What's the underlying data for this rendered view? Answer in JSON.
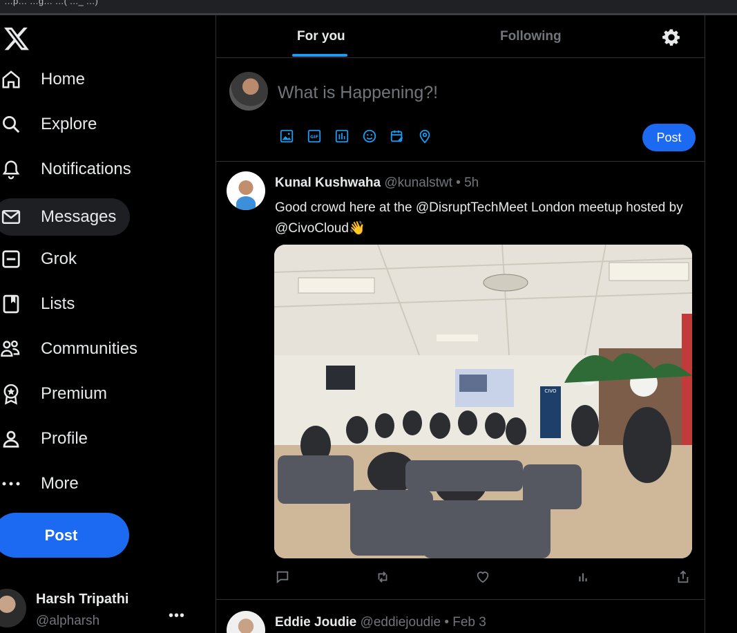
{
  "browser": {
    "url_fragment": "…p… …g… …( …_ …)"
  },
  "sidebar": {
    "items": [
      {
        "label": "Home",
        "icon": "home-icon"
      },
      {
        "label": "Explore",
        "icon": "search-icon"
      },
      {
        "label": "Notifications",
        "icon": "bell-icon"
      },
      {
        "label": "Messages",
        "icon": "envelope-icon",
        "active": true
      },
      {
        "label": "Grok",
        "icon": "grok-icon"
      },
      {
        "label": "Lists",
        "icon": "lists-icon"
      },
      {
        "label": "Communities",
        "icon": "communities-icon"
      },
      {
        "label": "Premium",
        "icon": "premium-icon"
      },
      {
        "label": "Profile",
        "icon": "profile-icon"
      },
      {
        "label": "More",
        "icon": "more-icon"
      }
    ],
    "post_label": "Post",
    "account": {
      "name": "Harsh Tripathi",
      "handle": "@alpharsh",
      "menu": "•••"
    }
  },
  "main": {
    "tabs": [
      {
        "label": "For you",
        "active": true
      },
      {
        "label": "Following",
        "active": false
      }
    ],
    "composer": {
      "placeholder": "What is Happening?!",
      "tools": [
        "image-icon",
        "gif-icon",
        "poll-icon",
        "emoji-icon",
        "schedule-icon",
        "location-icon"
      ],
      "post_label": "Post"
    },
    "tweets": [
      {
        "name": "Kunal Kushwaha",
        "handle": "@kunalstwt",
        "time": "• 5h",
        "text": "Good crowd here at the @DisruptTechMeet London meetup hosted by @CivoCloud👋",
        "actions": [
          "reply-icon",
          "retweet-icon",
          "like-icon",
          "views-icon",
          "share-icon"
        ]
      },
      {
        "name": "Eddie Joudie",
        "handle": "@eddiejoudie",
        "time": "• Feb 3"
      }
    ]
  },
  "colors": {
    "accent": "#1d9bf0",
    "button": "#1d6af2",
    "muted": "#71767b",
    "border": "#2f3336"
  }
}
